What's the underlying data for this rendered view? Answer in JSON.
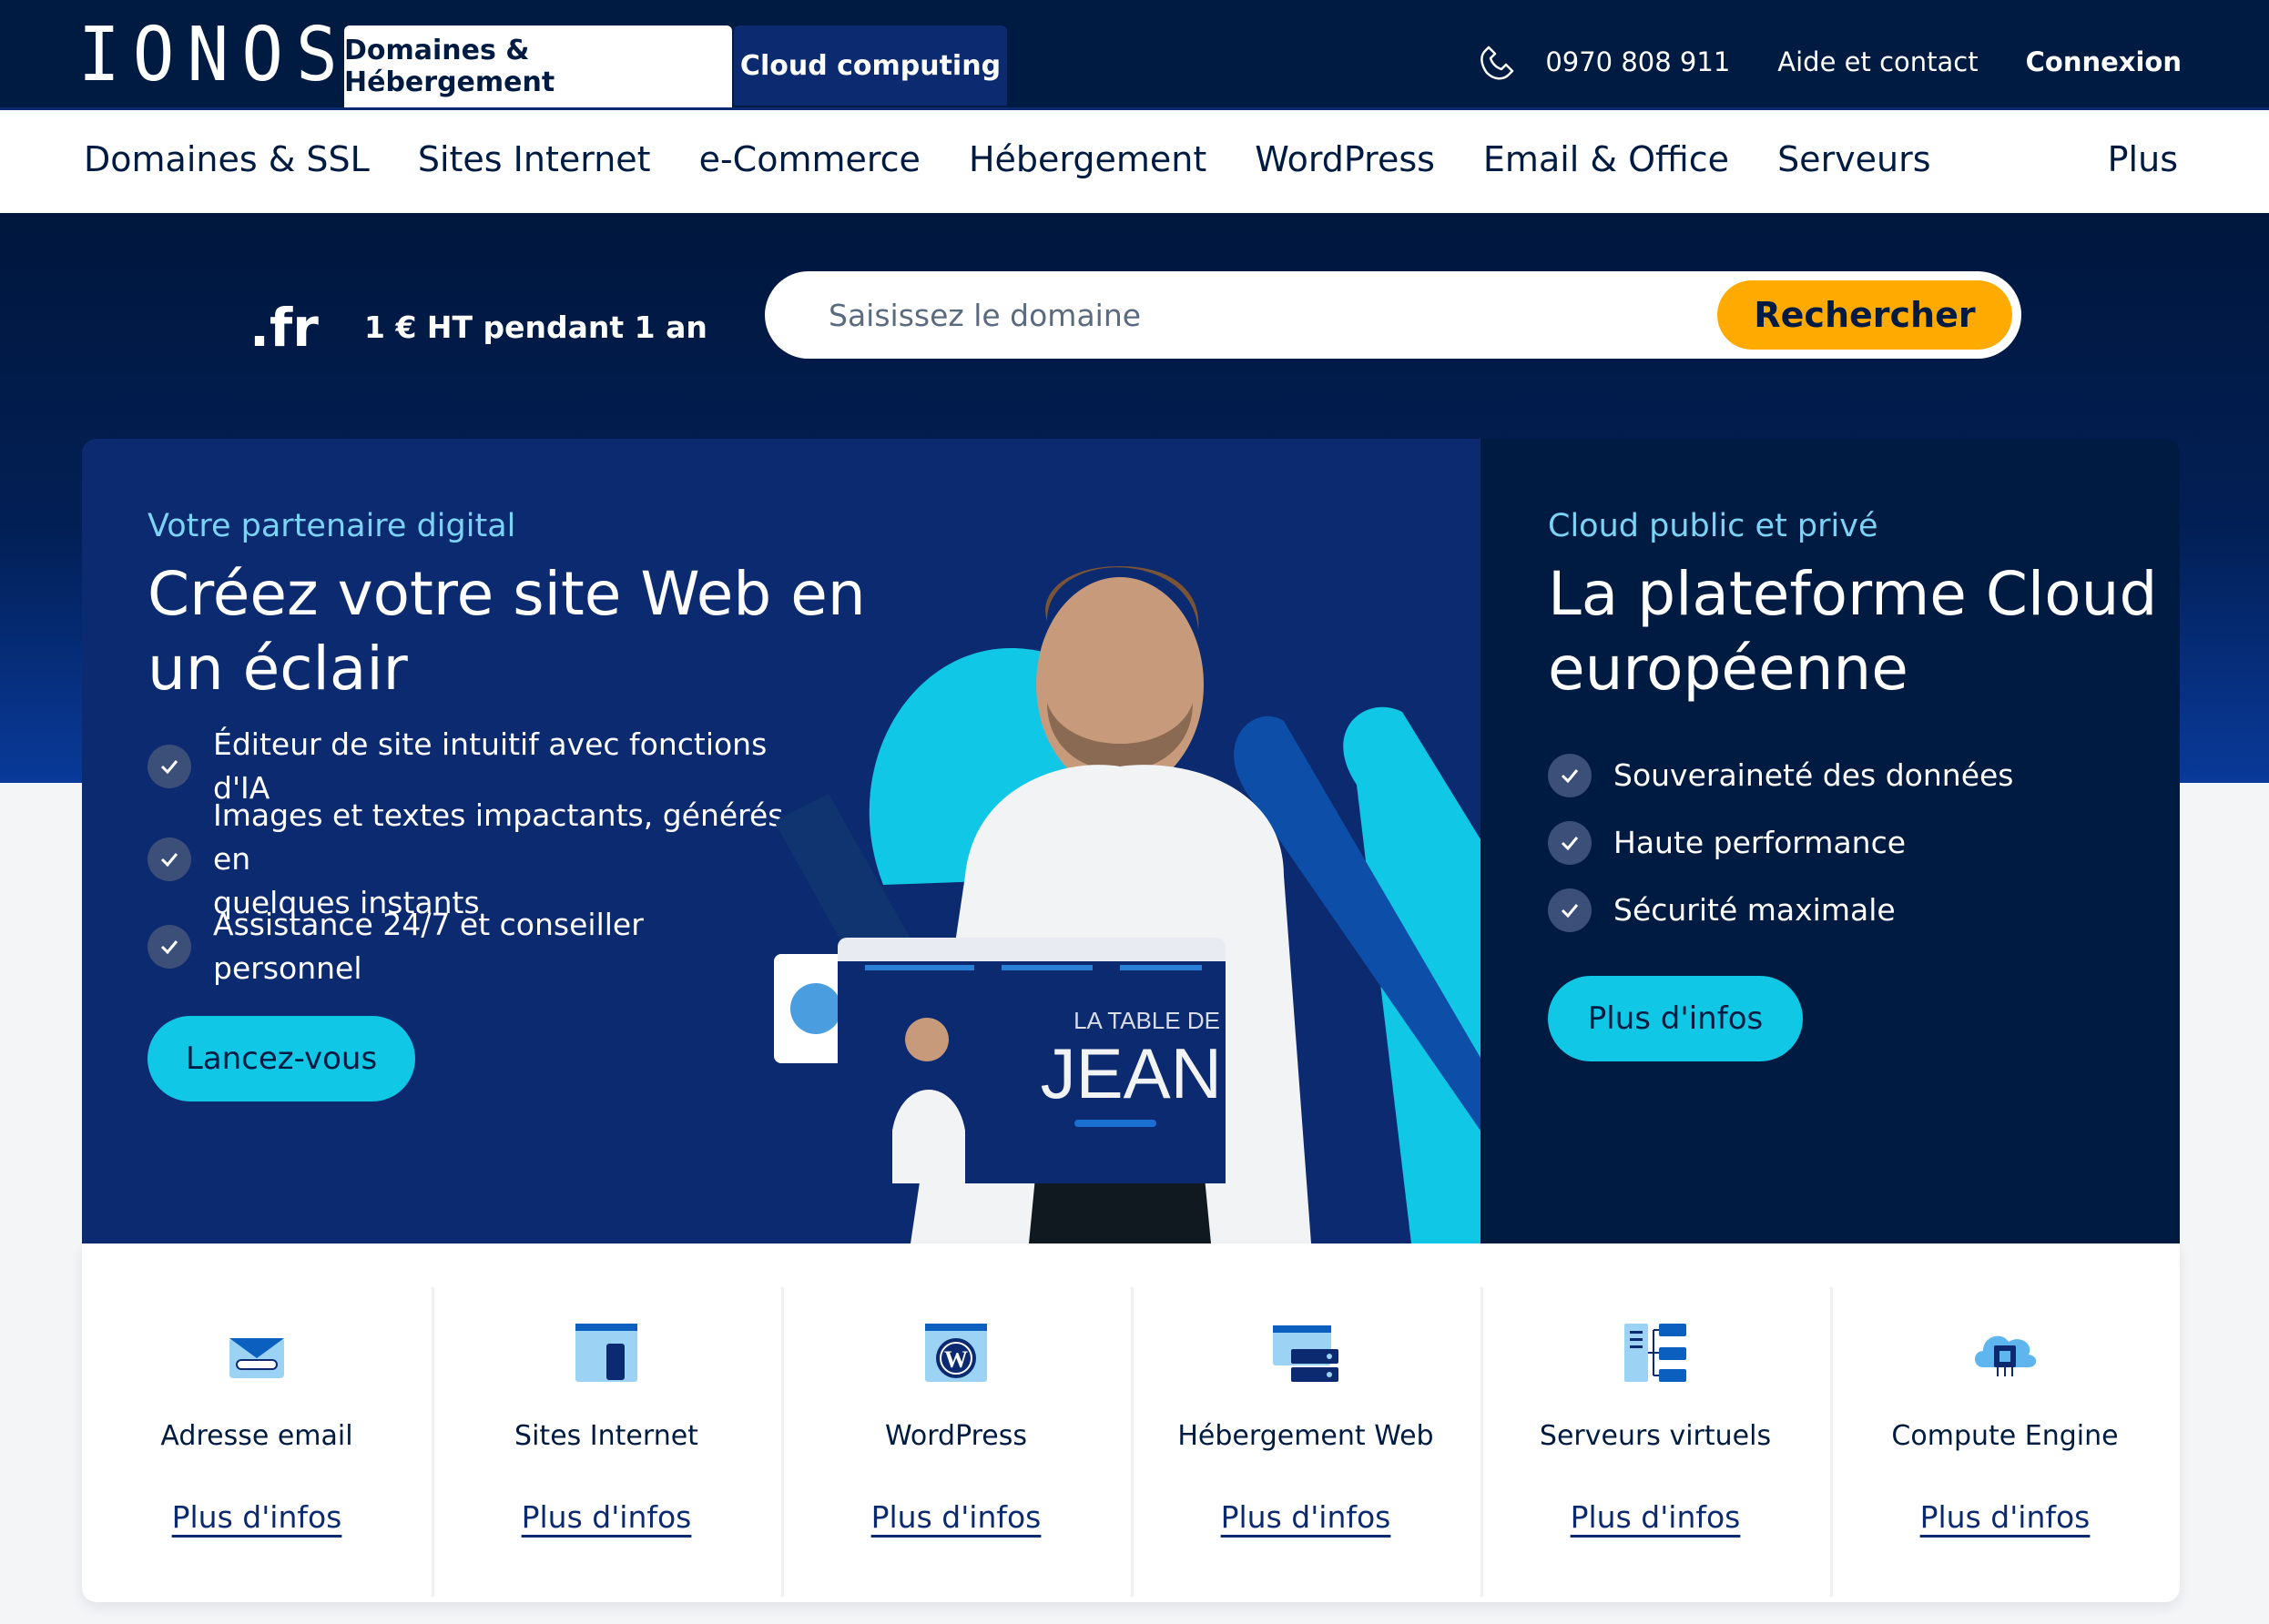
{
  "brand": {
    "logo": "IONOS"
  },
  "top_tabs": [
    {
      "label": "Domaines & Hébergement",
      "active": true
    },
    {
      "label": "Cloud computing",
      "active": false
    }
  ],
  "top_right": {
    "phone": "0970 808 911",
    "help": "Aide et contact",
    "login": "Connexion"
  },
  "nav": {
    "items": [
      "Domaines & SSL",
      "Sites Internet",
      "e-Commerce",
      "Hébergement",
      "WordPress",
      "Email & Office",
      "Serveurs"
    ],
    "more": "Plus"
  },
  "domain_search": {
    "tld": ".fr",
    "promo": "1 € HT pendant 1 an",
    "placeholder": "Saisissez le domaine",
    "button": "Rechercher"
  },
  "hero_left": {
    "eyebrow": "Votre partenaire digital",
    "headline_line1": "Créez votre site Web en",
    "headline_line2": "un éclair",
    "bullets": [
      {
        "line1": "Éditeur de site intuitif avec fonctions d'IA",
        "line2": ""
      },
      {
        "line1": "Images et textes impactants, générés en",
        "line2": "quelques instants"
      },
      {
        "line1": "Assistance 24/7 et conseiller personnel",
        "line2": ""
      }
    ],
    "cta": "Lancez-vous",
    "mockup_title_small": "LA TABLE DE",
    "mockup_title_big": "JEAN"
  },
  "hero_right": {
    "eyebrow": "Cloud public et privé",
    "headline_line1": "La plateforme Cloud",
    "headline_line2": "européenne",
    "bullets": [
      "Souveraineté des données",
      "Haute performance",
      "Sécurité maximale"
    ],
    "cta": "Plus d'infos"
  },
  "products": [
    {
      "title": "Adresse email",
      "link": "Plus d'infos",
      "icon": "email-icon"
    },
    {
      "title": "Sites Internet",
      "link": "Plus d'infos",
      "icon": "website-icon"
    },
    {
      "title": "WordPress",
      "link": "Plus d'infos",
      "icon": "wordpress-icon"
    },
    {
      "title": "Hébergement Web",
      "link": "Plus d'infos",
      "icon": "hosting-icon"
    },
    {
      "title": "Serveurs virtuels",
      "link": "Plus d'infos",
      "icon": "virtual-server-icon"
    },
    {
      "title": "Compute Engine",
      "link": "Plus d'infos",
      "icon": "compute-engine-icon"
    }
  ],
  "colors": {
    "navy": "#001b41",
    "blue": "#0b2a6f",
    "cyan": "#11c7e6",
    "orange": "#ffaa00",
    "light_blue_text": "#7dd3f6"
  }
}
